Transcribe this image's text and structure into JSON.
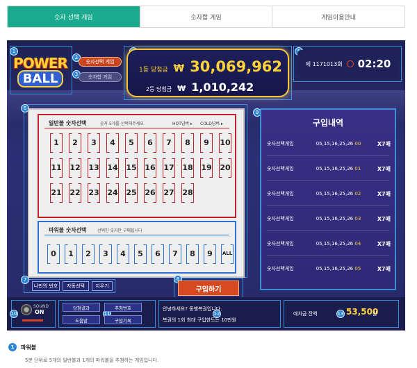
{
  "tabs": [
    {
      "label": "숫자 선택 게임",
      "active": true
    },
    {
      "label": "숫자합 게임",
      "active": false
    },
    {
      "label": "게임이용안내",
      "active": false
    }
  ],
  "logo": {
    "line1": "POWER",
    "line2": "BALL"
  },
  "modes": {
    "select": "숫자선택 게임",
    "sum": "숫자합 게임"
  },
  "jackpot": {
    "first_label": "1등 당첨금",
    "currency": "₩",
    "first_amount": "30,069,962",
    "second_label": "2등 당첨금",
    "second_amount": "1,010,242"
  },
  "round": {
    "label": "제 1171013회",
    "timer": "02:20"
  },
  "regular_pick": {
    "title": "일반볼 숫자선택",
    "hint": "숫자 5개를 선택해주세요",
    "hot": "HOT넘버 ▸",
    "cold": "COLD넘버 ▸",
    "numbers": [
      "1",
      "2",
      "3",
      "4",
      "5",
      "6",
      "7",
      "8",
      "9",
      "10",
      "11",
      "12",
      "13",
      "14",
      "15",
      "16",
      "17",
      "18",
      "19",
      "20",
      "21",
      "22",
      "23",
      "24",
      "25",
      "26",
      "27",
      "28"
    ]
  },
  "powerball_pick": {
    "title": "파워볼 숫자선택",
    "hint": "선택한 숫자만 구매됩니다",
    "numbers": [
      "0",
      "1",
      "2",
      "3",
      "4",
      "5",
      "6",
      "7",
      "8",
      "9",
      "ALL"
    ]
  },
  "controls": {
    "my_numbers": "나만의 번호",
    "auto": "자동선택",
    "clear": "지우기",
    "buy": "구입하기"
  },
  "history": {
    "title": "구입내역",
    "rows": [
      {
        "game": "숫자선택게임",
        "nums": "05,15,16,25,26",
        "last": "00",
        "count": "X7매"
      },
      {
        "game": "숫자선택게임",
        "nums": "05,15,16,25,26",
        "last": "01",
        "count": "X7매"
      },
      {
        "game": "숫자선택게임",
        "nums": "05,15,16,25,26",
        "last": "02",
        "count": "X7매"
      },
      {
        "game": "숫자선택게임",
        "nums": "05,15,16,25,26",
        "last": "03",
        "count": "X7매"
      },
      {
        "game": "숫자선택게임",
        "nums": "05,15,16,25,26",
        "last": "04",
        "count": "X7매"
      },
      {
        "game": "숫자선택게임",
        "nums": "05,15,16,25,26",
        "last": "05",
        "count": "X7매"
      }
    ]
  },
  "sound": {
    "label": "SOUND",
    "state": "ON"
  },
  "menu": {
    "result": "당첨결과",
    "draw": "추첨번호",
    "howto": "도움말",
    "record": "구입기록"
  },
  "message": {
    "line1": "안녕하세요? 동행복권입니다.",
    "line2": "복권의 1회 최대 구입한도는 10만원"
  },
  "balance": {
    "label": "예치금 잔액",
    "amount": "53,500",
    "unit": "원"
  },
  "info": {
    "badge": "1",
    "title": "파워볼",
    "desc": "5분 단위로 5개의 일반볼과 1개의 파워볼을 추첨하는 게임입니다."
  }
}
